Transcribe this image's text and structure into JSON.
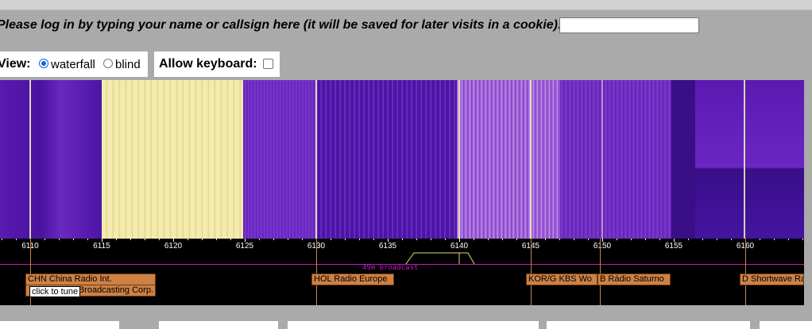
{
  "login": {
    "label": "Please log in by typing your name or callsign here (it will be saved for later visits in a cookie):",
    "value": "",
    "placeholder": ""
  },
  "view": {
    "label": "View:",
    "options": [
      "waterfall",
      "blind"
    ],
    "selected": "waterfall"
  },
  "keyboard": {
    "label": "Allow keyboard:",
    "checked": false
  },
  "scale": {
    "ticks": [
      "6110",
      "6115",
      "6120",
      "6125",
      "6130",
      "6135",
      "6140",
      "6145",
      "6150",
      "6155",
      "6160"
    ]
  },
  "band": {
    "label": "49m broadcast"
  },
  "stations": [
    {
      "label": "CHN China Radio Int."
    },
    {
      "label": "Broadcasting Corp."
    },
    {
      "label": "HOL Radio Europe"
    },
    {
      "label": "KOR/G KBS Wo"
    },
    {
      "label": "B Rádio Saturno"
    },
    {
      "label": "D Shortwave Ra"
    }
  ],
  "tooltip": {
    "text": "click to tune"
  },
  "colors": {
    "waterfall_bg": "#3a0e86",
    "signal_hot": "#f7f0c2",
    "station_tag": "#cd8145",
    "band_marker": "#c418c4"
  }
}
